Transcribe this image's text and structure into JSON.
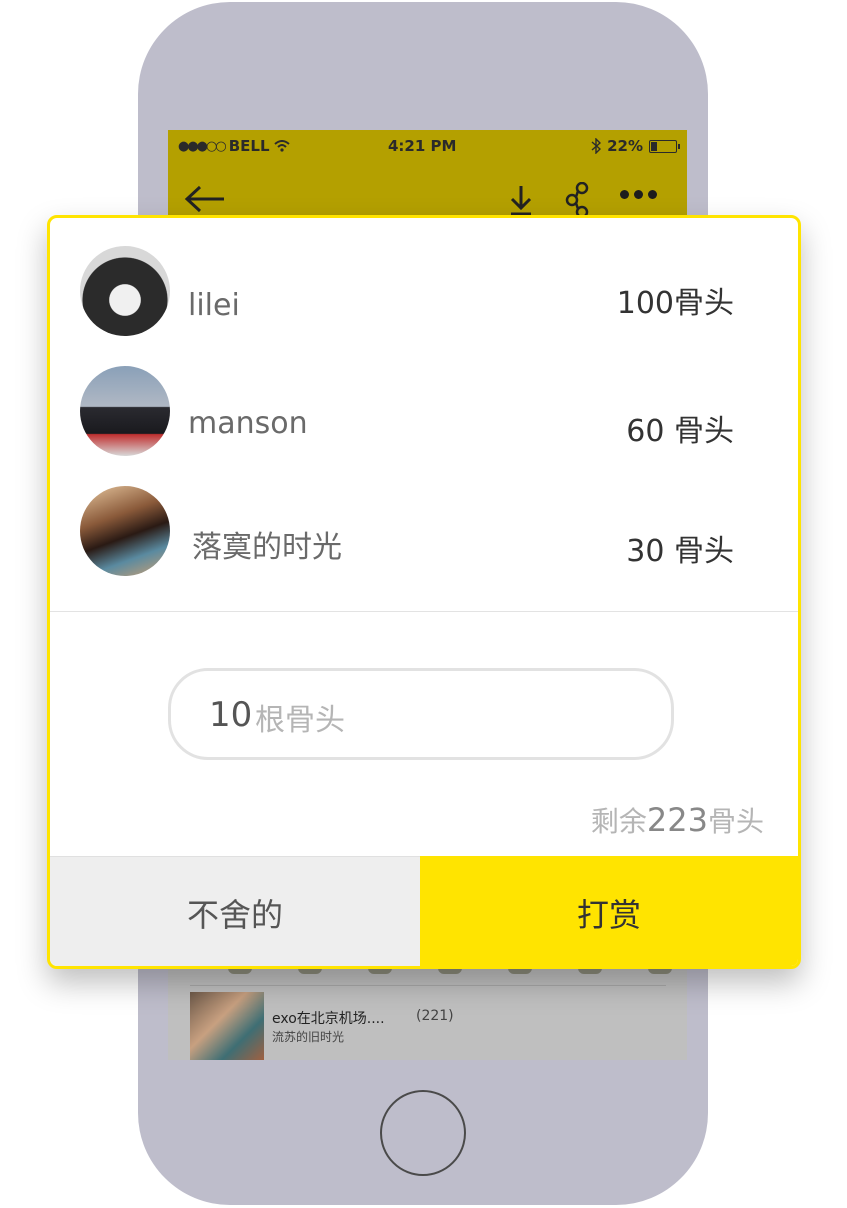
{
  "status_bar": {
    "signal": "●●●○○",
    "carrier": "BELL",
    "time": "4:21 PM",
    "battery": "22%"
  },
  "colors": {
    "accent": "#ffe400",
    "status_bar_bg": "#b4a000",
    "phone_body": "#bebdcb"
  },
  "nav_icons": [
    "back-arrow-icon",
    "download-icon",
    "share-icon",
    "more-icon"
  ],
  "rewarders": [
    {
      "name": "lilei",
      "amount": "100骨头"
    },
    {
      "name": "manson",
      "amount": "60  骨头"
    },
    {
      "name": "落寞的时光",
      "amount": "30  骨头"
    }
  ],
  "reward_input": {
    "value": "10",
    "unit": "根骨头"
  },
  "balance": {
    "prefix": "剩余",
    "amount": "223",
    "suffix": "骨头"
  },
  "buttons": {
    "cancel": "不舍的",
    "confirm": "打赏"
  },
  "background_list_item": {
    "title": "exo在北京机场....",
    "count": "(221)",
    "subtitle": "流苏的旧时光"
  }
}
